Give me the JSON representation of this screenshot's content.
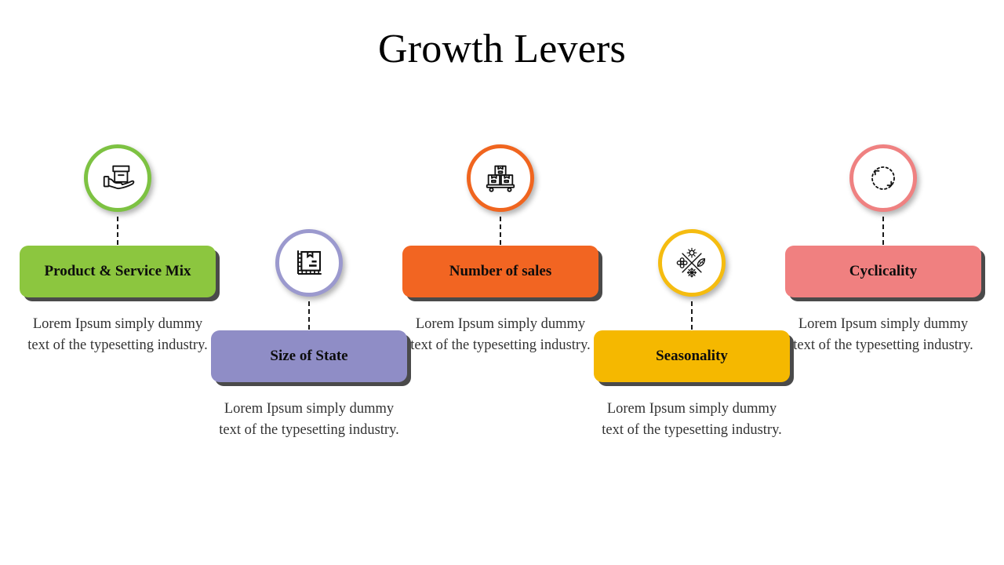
{
  "slide": {
    "title": "Growth Levers",
    "background": "#FFFFFF"
  },
  "items": [
    {
      "id": "product-service-mix",
      "label": "Product & Service Mix",
      "description": "Lorem Ipsum simply dummy text of the typesetting industry.",
      "color": "#8CC63F",
      "ring_color": "#7DC242",
      "icon": "hand-holding-box-icon",
      "position": "top"
    },
    {
      "id": "size-of-state",
      "label": "Size of State",
      "description": "Lorem Ipsum simply dummy text of the typesetting industry.",
      "color": "#8F8DC6",
      "ring_color": "#9B99CE",
      "icon": "box-with-ruler-icon",
      "position": "bottom"
    },
    {
      "id": "number-of-sales",
      "label": "Number of sales",
      "description": "Lorem Ipsum simply dummy text of the typesetting industry.",
      "color": "#F26522",
      "ring_color": "#F0651F",
      "icon": "stacked-boxes-icon",
      "position": "top"
    },
    {
      "id": "seasonality",
      "label": "Seasonality",
      "description": "Lorem Ipsum simply dummy text of the typesetting industry.",
      "color": "#F5B800",
      "ring_color": "#F5BC10",
      "icon": "four-seasons-icon",
      "position": "bottom"
    },
    {
      "id": "cyclicality",
      "label": "Cyclicality",
      "description": "Lorem Ipsum simply dummy text of the typesetting industry.",
      "color": "#F08080",
      "ring_color": "#EF8181",
      "icon": "circular-cycle-arrows-icon",
      "position": "top"
    }
  ]
}
